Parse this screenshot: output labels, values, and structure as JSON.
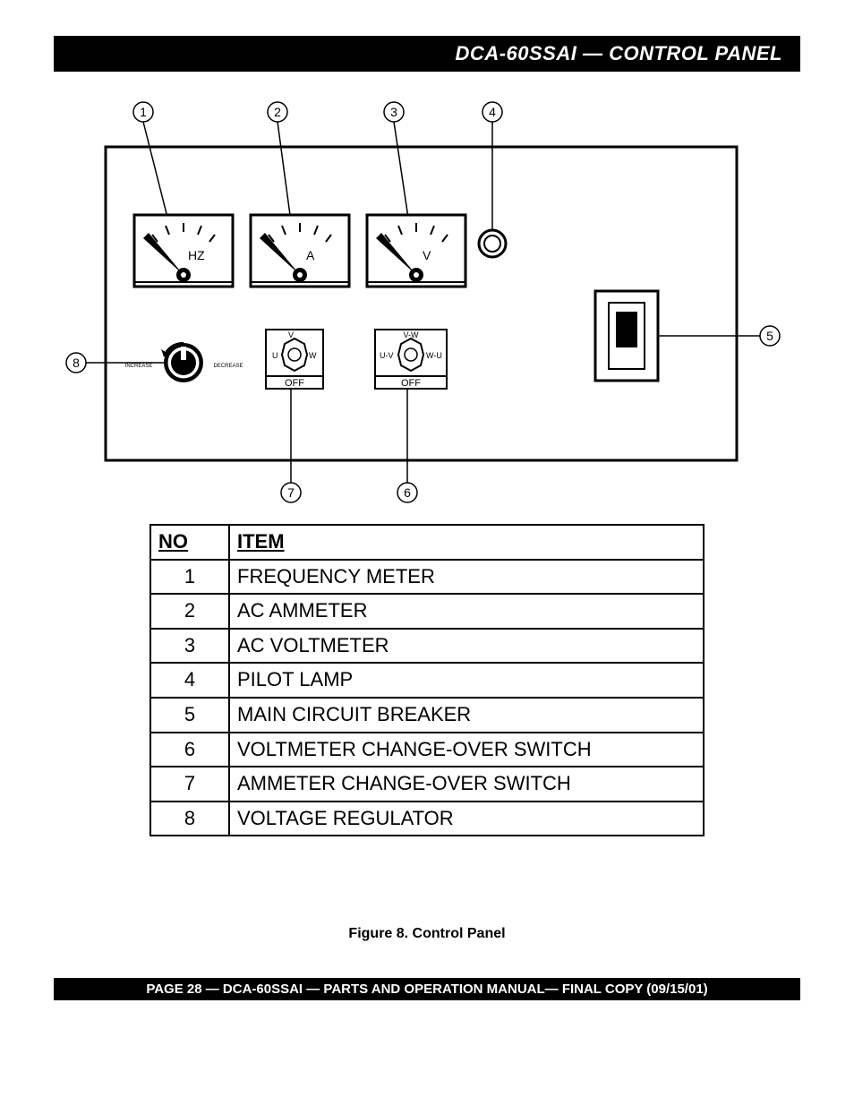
{
  "header": {
    "title": "DCA-60SSAI  — CONTROL PANEL"
  },
  "diagram": {
    "gauges": {
      "g1": "HZ",
      "g2": "A",
      "g3": "V"
    },
    "ammeter_switch": {
      "top": "V",
      "left": "U",
      "right": "W",
      "off": "OFF"
    },
    "voltmeter_switch": {
      "top": "V-W",
      "left": "U-V",
      "right": "W-U",
      "off": "OFF"
    },
    "regulator": {
      "increase": "INCREASE",
      "decrease": "DECREASE"
    },
    "callouts": {
      "c1": "1",
      "c2": "2",
      "c3": "3",
      "c4": "4",
      "c5": "5",
      "c6": "6",
      "c7": "7",
      "c8": "8"
    }
  },
  "table": {
    "header_no": "NO",
    "header_item": "ITEM",
    "rows": [
      {
        "no": "1",
        "item": "FREQUENCY METER"
      },
      {
        "no": "2",
        "item": "AC AMMETER"
      },
      {
        "no": "3",
        "item": "AC VOLTMETER"
      },
      {
        "no": "4",
        "item": "PILOT LAMP"
      },
      {
        "no": "5",
        "item": "MAIN CIRCUIT BREAKER"
      },
      {
        "no": "6",
        "item": "VOLTMETER CHANGE-OVER SWITCH"
      },
      {
        "no": "7",
        "item": "AMMETER  CHANGE-OVER SWITCH"
      },
      {
        "no": "8",
        "item": "VOLTAGE REGULATOR"
      }
    ]
  },
  "caption": "Figure 8. Control Panel",
  "footer": "PAGE 28 — DCA-60SSAI — PARTS AND OPERATION  MANUAL— FINAL COPY  (09/15/01)"
}
